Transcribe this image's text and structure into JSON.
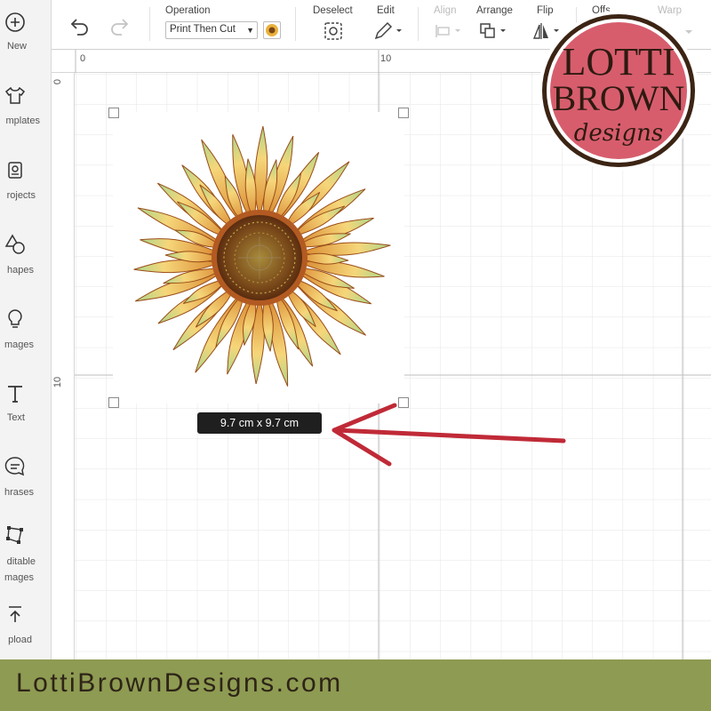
{
  "sidebar": {
    "items": [
      {
        "label": "New",
        "icon": "plus-circle-icon"
      },
      {
        "label": "mplates",
        "icon": "shirt-icon"
      },
      {
        "label": "rojects",
        "icon": "projects-icon"
      },
      {
        "label": "hapes",
        "icon": "shapes-icon"
      },
      {
        "label": "mages",
        "icon": "lightbulb-icon"
      },
      {
        "label": "Text",
        "icon": "text-icon"
      },
      {
        "label": "hrases",
        "icon": "phrases-icon"
      },
      {
        "label": "ditable",
        "label2": "mages",
        "icon": "editable-images-icon"
      },
      {
        "label": "pload",
        "icon": "upload-icon"
      }
    ]
  },
  "toolbar": {
    "operation_label": "Operation",
    "operation_value": "Print Then Cut",
    "deselect_label": "Deselect",
    "edit_label": "Edit",
    "align_label": "Align",
    "arrange_label": "Arrange",
    "flip_label": "Flip",
    "offset_label": "Offs",
    "warp_label": "Warp"
  },
  "canvas": {
    "ruler_top": [
      "0",
      "10"
    ],
    "ruler_left": [
      "0",
      "10"
    ],
    "size_tooltip": "9.7  cm x 9.7  cm"
  },
  "logo": {
    "line1": "LOTTI",
    "line2": "BROWN",
    "line3": "designs"
  },
  "footer": {
    "text": "LottiBrownDesigns.com"
  },
  "colors": {
    "logo_fill": "#d75d6d",
    "logo_ring": "#3c2414",
    "arrow": "#c02a37",
    "footer_bg": "#8e9b52"
  }
}
